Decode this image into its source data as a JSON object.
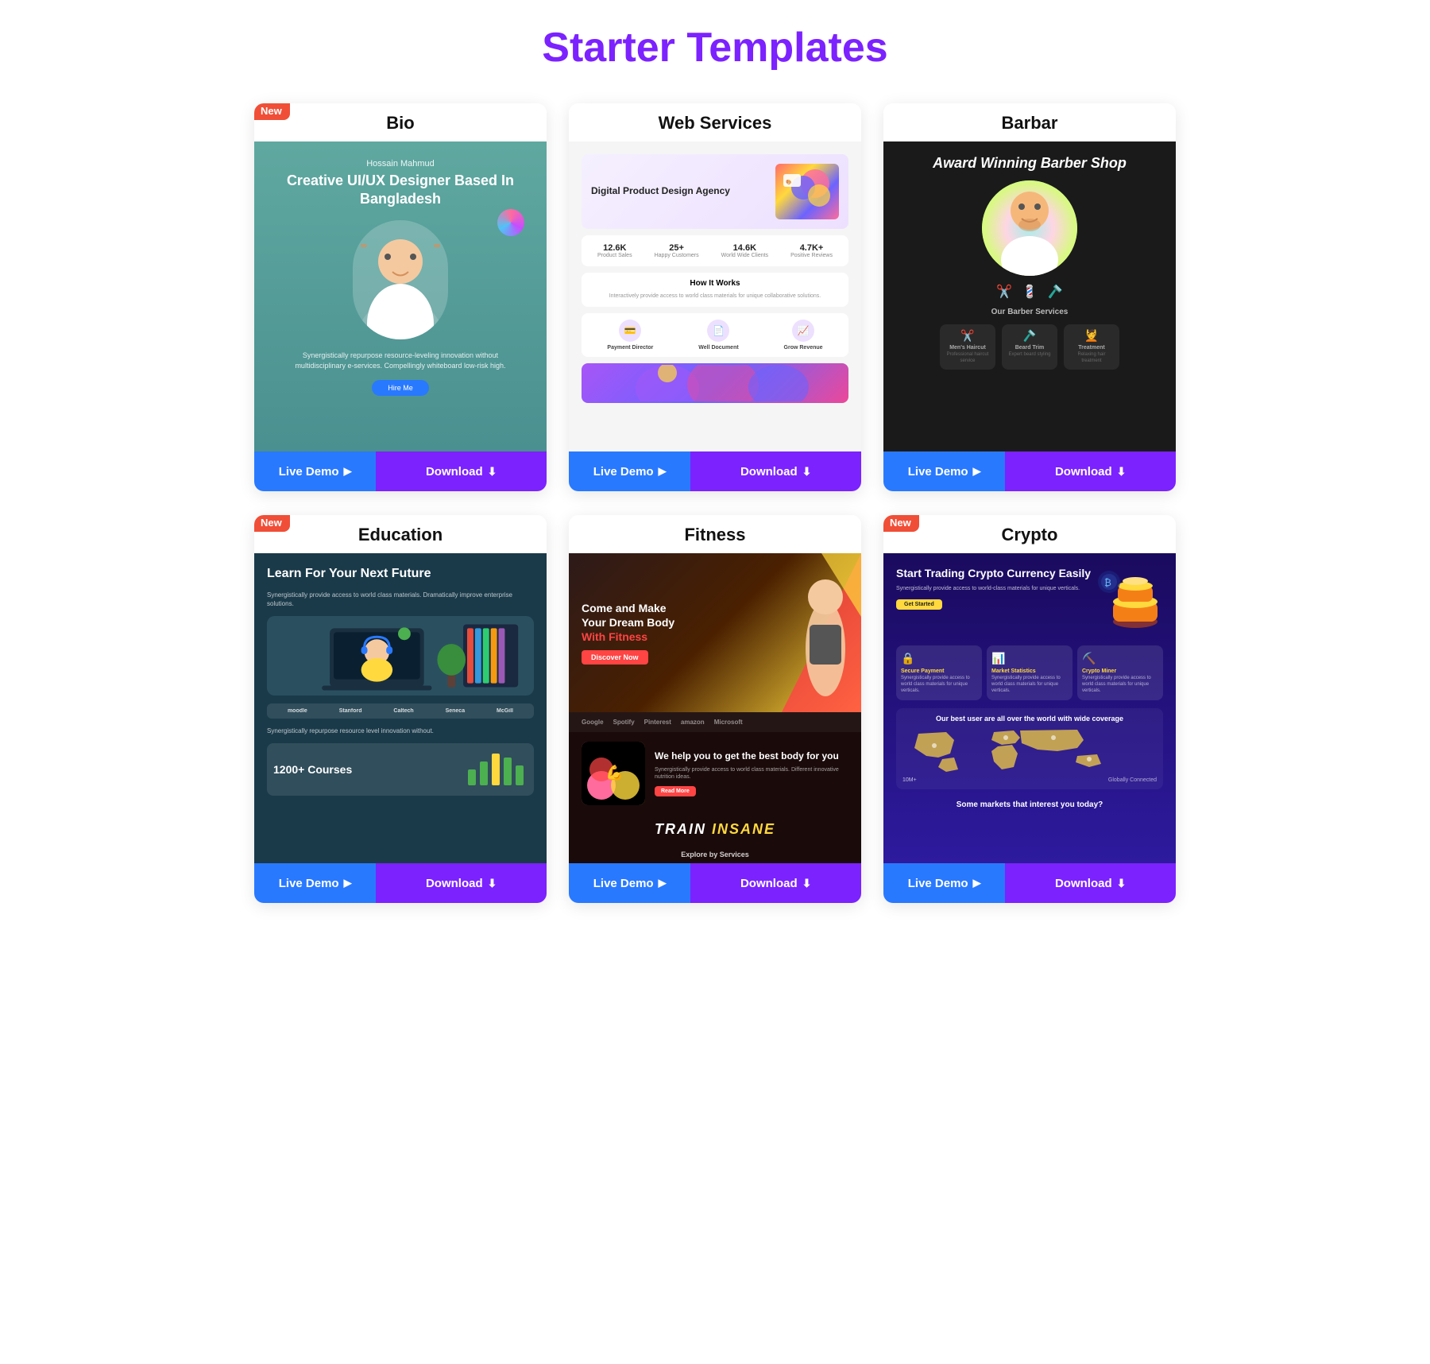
{
  "page": {
    "title": "Starter Templates"
  },
  "templates": [
    {
      "id": "bio",
      "name": "Bio",
      "is_new": true,
      "live_demo_label": "Live Demo",
      "download_label": "Download",
      "preview": {
        "person_name": "Hossain Mahmud",
        "headline": "Creative UI/UX Designer Based In Bangladesh",
        "description": "Synergistically repurpose resource-leveling innovation without multidisciplinary e-services. Compellingly whiteboard low-risk high.",
        "bg_color": "#5fa8a0"
      }
    },
    {
      "id": "web-services",
      "name": "Web Services",
      "is_new": false,
      "live_demo_label": "Live Demo",
      "download_label": "Download",
      "preview": {
        "hero_title": "Digital Product Design Agency",
        "stat1_num": "12.6K",
        "stat1_label": "Product Sales",
        "stat2_num": "25+",
        "stat2_label": "Happy Customers",
        "stat3_num": "14.6K",
        "stat3_label": "World Wide Clients",
        "stat4_num": "4.7K+",
        "stat4_label": "Positive Reviews",
        "how_title": "How It Works",
        "feat1": "Payment Director",
        "feat2": "Well Document",
        "feat3": "Grow Revenue"
      }
    },
    {
      "id": "barbar",
      "name": "Barbar",
      "is_new": false,
      "live_demo_label": "Live Demo",
      "download_label": "Download",
      "preview": {
        "headline": "Award Winning Barber Shop",
        "services_title": "Our Barber Services",
        "svc1_name": "Men's Haircut",
        "svc2_name": "Beard Trim",
        "svc3_name": "Treatment"
      }
    },
    {
      "id": "education",
      "name": "Education",
      "is_new": true,
      "live_demo_label": "Live Demo",
      "download_label": "Download",
      "preview": {
        "headline": "Learn For Your Next Future",
        "desc": "Synergistically repurpose resource level innovation without.",
        "logo1": "moodle",
        "logo2": "Stanford",
        "logo3": "Caltech",
        "logo4": "Seneca",
        "logo5": "McGill",
        "courses_num": "1200+ Courses"
      }
    },
    {
      "id": "fitness",
      "name": "Fitness",
      "is_new": false,
      "live_demo_label": "Live Demo",
      "download_label": "Download",
      "preview": {
        "headline": "Come and Make Your Dream Body With Fitness",
        "subtitle": "Discover Now",
        "section_title": "We help you to get the best body for you",
        "brand1": "Google",
        "brand2": "Spotify",
        "brand3": "Pinterest",
        "brand4": "amazon",
        "brand5": "Microsoft",
        "explore_label": "Explore by Services"
      }
    },
    {
      "id": "crypto",
      "name": "Crypto",
      "is_new": true,
      "live_demo_label": "Live Demo",
      "download_label": "Download",
      "preview": {
        "headline": "Start Trading Crypto Currency Easily",
        "desc": "Synergistically provide access to world-class materials for unique verticals.",
        "card1_title": "Secure Payment",
        "card2_title": "Market Statistics",
        "card3_title": "Crypto Miner",
        "map_title": "Our best user are all over the world with wide coverage",
        "map_subtitle": "10M+",
        "bottom_title": "Some markets that interest you today?"
      }
    }
  ]
}
